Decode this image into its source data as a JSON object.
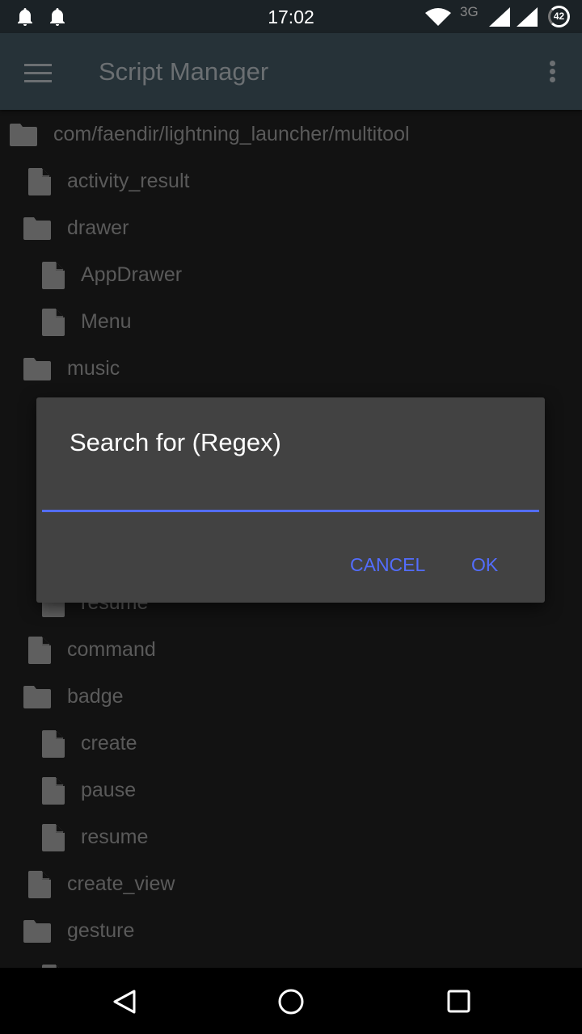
{
  "status_bar": {
    "time": "17:02",
    "network": "3G",
    "battery": "42",
    "icons": [
      "bell-icon",
      "bell-icon",
      "wifi-icon",
      "signal-icon",
      "signal-icon",
      "battery-icon"
    ]
  },
  "app_bar": {
    "title": "Script Manager",
    "menu_icon": "hamburger-icon",
    "overflow_icon": "more-vert-icon"
  },
  "tree": [
    {
      "row": 0,
      "level": 0,
      "type": "folder",
      "label": "com/faendir/lightning_launcher/multitool"
    },
    {
      "row": 1,
      "level": 1,
      "type": "file",
      "label": "activity_result"
    },
    {
      "row": 2,
      "level": 1,
      "type": "folder",
      "label": "drawer"
    },
    {
      "row": 3,
      "level": 2,
      "type": "file",
      "label": "AppDrawer"
    },
    {
      "row": 4,
      "level": 2,
      "type": "file",
      "label": "Menu"
    },
    {
      "row": 5,
      "level": 1,
      "type": "folder",
      "label": "music"
    },
    {
      "row": 10,
      "level": 2,
      "type": "file",
      "label": "resume"
    },
    {
      "row": 11,
      "level": 1,
      "type": "file",
      "label": "command"
    },
    {
      "row": 12,
      "level": 1,
      "type": "folder",
      "label": "badge"
    },
    {
      "row": 13,
      "level": 2,
      "type": "file",
      "label": "create"
    },
    {
      "row": 14,
      "level": 2,
      "type": "file",
      "label": "pause"
    },
    {
      "row": 15,
      "level": 2,
      "type": "file",
      "label": "resume"
    },
    {
      "row": 16,
      "level": 1,
      "type": "file",
      "label": "create_view"
    },
    {
      "row": 17,
      "level": 1,
      "type": "folder",
      "label": "gesture"
    },
    {
      "row": 18,
      "level": 2,
      "type": "file",
      "label": ""
    }
  ],
  "dialog": {
    "title": "Search for (Regex)",
    "input_value": "",
    "cancel_label": "CANCEL",
    "ok_label": "OK",
    "accent": "#536dfe"
  },
  "nav_bar": {
    "icons": [
      "back-icon",
      "home-icon",
      "recents-icon"
    ]
  }
}
